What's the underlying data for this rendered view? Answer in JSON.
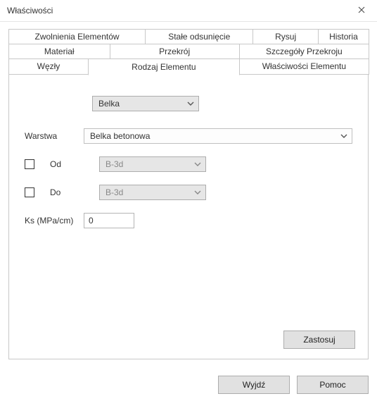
{
  "window": {
    "title": "Właściwości"
  },
  "tabs": {
    "row1": [
      "Zwolnienia Elementów",
      "Stałe odsunięcie",
      "Rysuj",
      "Historia"
    ],
    "row2": [
      "Materiał",
      "Przekrój",
      "Szczegóły Przekroju"
    ],
    "row3": [
      "Węzły",
      "Rodzaj Elementu",
      "Właściwości Elementu"
    ],
    "active": "Rodzaj Elementu"
  },
  "form": {
    "type_select": "Belka",
    "layer_label": "Warstwa",
    "layer_value": "Belka betonowa",
    "from_label": "Od",
    "from_value": "B-3d",
    "to_label": "Do",
    "to_value": "B-3d",
    "ks_label": "Ks (MPa/cm)",
    "ks_value": "0"
  },
  "buttons": {
    "apply": "Zastosuj",
    "exit": "Wyjdź",
    "help": "Pomoc"
  }
}
